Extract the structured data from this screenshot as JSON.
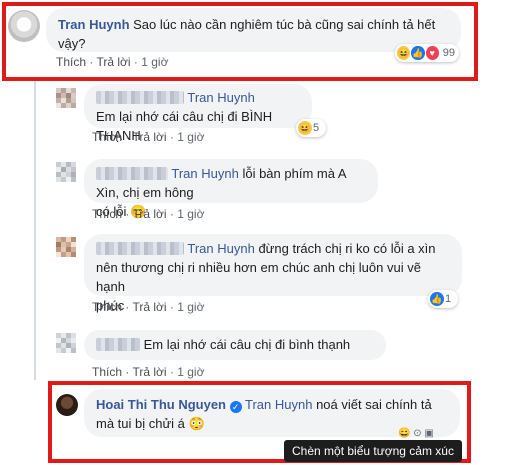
{
  "comments": [
    {
      "author": "Tran Huynh",
      "text_line1": "Sao lúc nào cần nghiêm túc bà cũng sai chính tả hết",
      "text_line2": "vậy?",
      "reaction_count": "99",
      "like": "Thích",
      "reply": "Trả lời",
      "time": "1 giờ"
    },
    {
      "tag": "Tran Huynh",
      "text": "Em lại nhớ cái câu chị đi BÌNH THẠNH",
      "reaction_count": "5",
      "like": "Thích",
      "reply": "Trả lời",
      "time": "1 giờ"
    },
    {
      "tag": "Tran Huynh",
      "text_after_tag": "lỗi bàn phím mà A Xìn, chị em hông",
      "text_line2": "có lỗi",
      "like": "Thích",
      "reply": "Trả lời",
      "time": "1 giờ"
    },
    {
      "tag": "Tran Huynh",
      "text_after_tag": "đừng trách chị ri ko có lỗi a xìn",
      "text_line2": "nên thương chị ri nhiều hơn em chúc anh chị luôn vui vẽ hạnh",
      "text_line3": "phúc",
      "reaction_count": "1",
      "like": "Thích",
      "reply": "Trả lời",
      "time": "1 giờ"
    },
    {
      "text": "Em lại nhớ cái câu chị đi bình thạnh",
      "like": "Thích",
      "reply": "Trả lời",
      "time": "1 giờ"
    },
    {
      "author": "Hoai Thi Thu Nguyen",
      "tag": "Tran Huynh",
      "text_after_tag": "noá viết sai chính tả",
      "text_line2": "mà tui bị chửi á"
    }
  ],
  "tooltip": "Chèn một biểu tượng cảm xúc",
  "colors": {
    "link": "#385898",
    "bubble": "#f2f3f5",
    "highlight": "#e0191b"
  }
}
